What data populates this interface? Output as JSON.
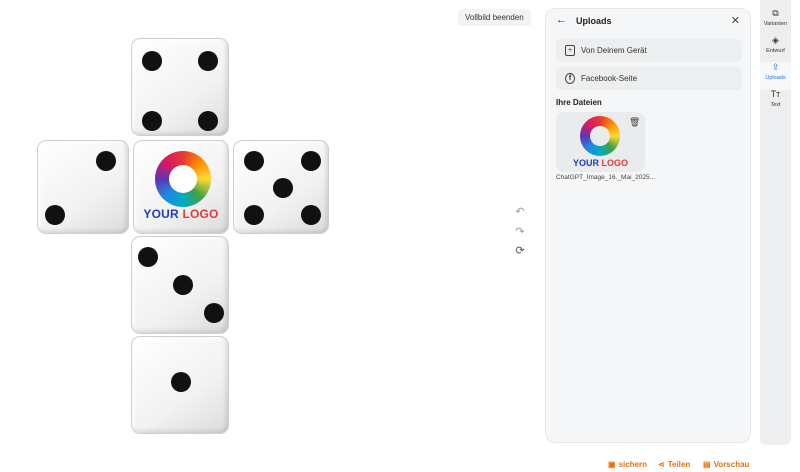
{
  "canvas": {
    "logo_line1": "YOUR",
    "logo_line2": "LOGO"
  },
  "tooltip": {
    "text": "Vollbild beenden"
  },
  "history": {
    "undo_icon": "undo-icon",
    "redo_icon": "redo-icon",
    "refresh_icon": "refresh-icon"
  },
  "panel": {
    "back_icon": "←",
    "title": "Uploads",
    "close_icon": "✕",
    "sources": [
      {
        "label": "Von Deinem Gerät",
        "icon": "device-upload-icon",
        "glyph": "+"
      },
      {
        "label": "Facebook-Seite",
        "icon": "facebook-icon",
        "glyph": "f"
      }
    ],
    "files_heading": "Ihre Dateien",
    "file": {
      "name": "ChatGPT_Image_16._Mai_2025...",
      "logo_line1": "YOUR",
      "logo_line2": "LOGO"
    }
  },
  "sidebar": {
    "items": [
      {
        "label": "Varianten",
        "icon": "variants-icon",
        "glyph": "⧉"
      },
      {
        "label": "Entwurf",
        "icon": "layers-icon",
        "glyph": "◈"
      },
      {
        "label": "Uploads",
        "icon": "upload-icon",
        "glyph": "⇪",
        "active": true
      },
      {
        "label": "Text",
        "icon": "text-icon",
        "glyph": "Tт"
      }
    ]
  },
  "footer": {
    "save_label": "sichern",
    "share_label": "Teilen",
    "preview_label": "Vorschau"
  },
  "colors": {
    "accent": "#e8710a",
    "active": "#1a73e8",
    "logo_blue": "#1e3fbf",
    "logo_red": "#e53935"
  }
}
